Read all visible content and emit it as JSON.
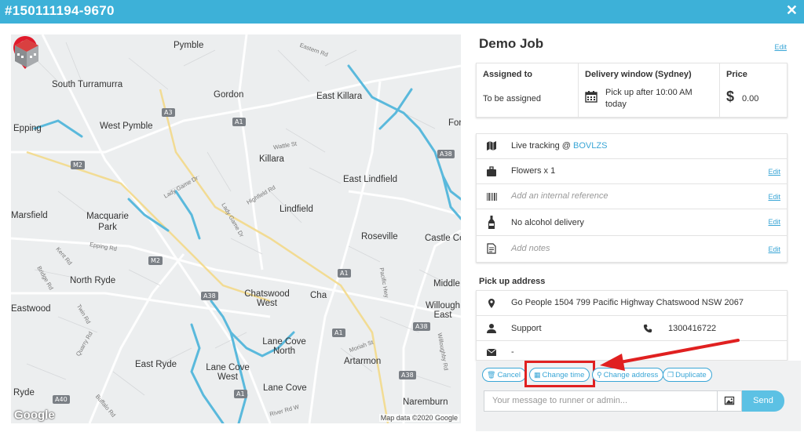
{
  "header": {
    "title": "#150111194-9670",
    "close_icon": "close-icon"
  },
  "map": {
    "labels": [
      "Pymble",
      "South Turramurra",
      "Gordon",
      "East Killara",
      "Epping",
      "West Pymble",
      "Killara",
      "East Lindfield",
      "Lindfield",
      "Marsfield",
      "Macquarie Park",
      "Roseville",
      "Castle Co",
      "North Ryde",
      "Chatswood West",
      "Cha",
      "Middle",
      "Willough East",
      "Lane Cove North",
      "Artarmon",
      "East Ryde",
      "Lane Cove West",
      "Lane Cove",
      "Naremburn",
      "Ryde",
      "Eastwood",
      "For"
    ],
    "road_shields": [
      "A3",
      "A1",
      "M2",
      "A38",
      "M2",
      "A1",
      "A1",
      "A38",
      "A40",
      "A38",
      "A1",
      "A38"
    ],
    "road_labels": [
      "Eastern Rd",
      "Lady Game Dr",
      "Highfield Rd",
      "Wattle St",
      "Epping Rd",
      "Kent Rd",
      "Bridge Rd",
      "Twin Rd",
      "Quarry Rd",
      "Buffalo Rd",
      "Moriah St",
      "Willoughby Rd",
      "Pacific Hwy",
      "River Rd W",
      "Lady Game Dr"
    ],
    "google": "Google",
    "attribution": "Map data ©2020 Google",
    "pin_icon": "map-pin-check-icon",
    "building_icon": "building-icon"
  },
  "job": {
    "title": "Demo Job",
    "edit_label": "Edit",
    "assigned": {
      "heading": "Assigned to",
      "value": "To be assigned"
    },
    "window": {
      "heading": "Delivery window (Sydney)",
      "line1": "Pick up after 10:00 AM",
      "line2": "today",
      "icon": "calendar-icon"
    },
    "price": {
      "heading": "Price",
      "value": "0.00",
      "icon": "dollar-icon"
    }
  },
  "details": [
    {
      "icon": "map-icon",
      "text": "Live tracking @ ",
      "link": "BOVLZS",
      "edit": ""
    },
    {
      "icon": "briefcase-icon",
      "text": "Flowers x 1",
      "edit": "Edit"
    },
    {
      "icon": "barcode-icon",
      "text": "Add an internal reference",
      "edit": "Edit",
      "placeholder": true
    },
    {
      "icon": "bottle-icon",
      "text": "No alcohol delivery",
      "edit": "Edit"
    },
    {
      "icon": "notes-icon",
      "text": "Add notes",
      "edit": "Edit",
      "placeholder": true
    }
  ],
  "pickup": {
    "heading": "Pick up address",
    "address": "Go People 1504 799 Pacific Highway Chatswood NSW 2067",
    "contact": "Support",
    "phone": "1300416722",
    "email": "-"
  },
  "actions": {
    "cancel": "Cancel",
    "change_time": "Change time",
    "change_address": "Change address",
    "duplicate": "Duplicate"
  },
  "message": {
    "placeholder": "Your message to runner or admin...",
    "send": "Send"
  },
  "colors": {
    "accent": "#3db1d8",
    "link": "#3aa6d6",
    "highlight": "#e02020",
    "water": "#5ab9dc",
    "send": "#5cc1e4"
  }
}
